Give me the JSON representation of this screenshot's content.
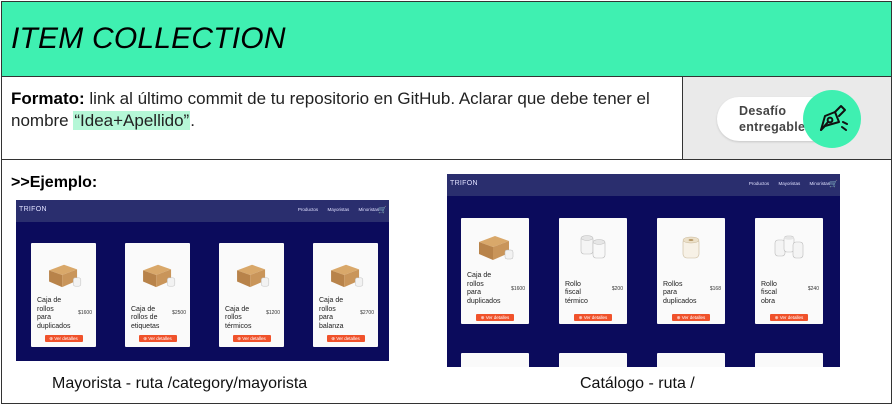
{
  "header": {
    "title": "ITEM COLLECTION"
  },
  "format": {
    "label": "Formato:",
    "text": " link al último commit de tu repositorio en GitHub. Aclarar que debe tener el nombre ",
    "highlight": "“Idea+Apellido”",
    "tail": "."
  },
  "badge": {
    "line1": "Desafío",
    "line2": "entregable",
    "icon": "pen-tool-icon"
  },
  "example": {
    "label": ">>Ejemplo:"
  },
  "left_shot": {
    "brand": "TRIFON",
    "nav": [
      "Productos",
      "Mayoristas",
      "Minoristas"
    ],
    "cards": [
      {
        "name": [
          "Caja de",
          "rollos",
          "para",
          "duplicados"
        ],
        "price": "$1600",
        "button": "Ver detalles",
        "img": "box"
      },
      {
        "name": [
          "Caja de",
          "rollos de",
          "etiquetas"
        ],
        "price": "$2500",
        "button": "Ver detalles",
        "img": "box"
      },
      {
        "name": [
          "Caja de",
          "rollos",
          "térmicos"
        ],
        "price": "$1200",
        "button": "Ver detalles",
        "img": "box"
      },
      {
        "name": [
          "Caja de",
          "rollos",
          "para",
          "balanza"
        ],
        "price": "$2700",
        "button": "Ver detalles",
        "img": "box"
      }
    ],
    "caption": "Mayorista - ruta /category/mayorista"
  },
  "right_shot": {
    "brand": "TRIFON",
    "nav": [
      "Productos",
      "Mayoristas",
      "Minoristas"
    ],
    "cards": [
      {
        "name": [
          "Caja de",
          "rollos",
          "para",
          "duplicados"
        ],
        "price": "$1600",
        "button": "Ver detalles",
        "img": "box"
      },
      {
        "name": [
          "Rollo",
          "fiscal",
          "térmico"
        ],
        "price": "$200",
        "button": "Ver detalles",
        "img": "rolls2"
      },
      {
        "name": [
          "Rollos",
          "para",
          "duplicados"
        ],
        "price": "$168",
        "button": "Ver detalles",
        "img": "roll1"
      },
      {
        "name": [
          "Rollo",
          "fiscal",
          "obra"
        ],
        "price": "$240",
        "button": "Ver detalles",
        "img": "rolls3"
      }
    ],
    "caption": "Catálogo - ruta /"
  }
}
